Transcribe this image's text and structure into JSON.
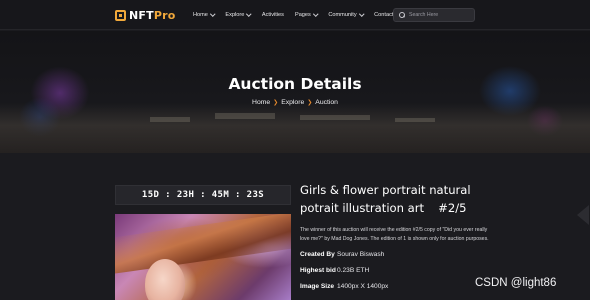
{
  "header": {
    "logo": {
      "prefix": "NFT",
      "suffix": "Pro"
    },
    "nav": [
      {
        "label": "Home",
        "has_dropdown": true
      },
      {
        "label": "Explore",
        "has_dropdown": true
      },
      {
        "label": "Activities",
        "has_dropdown": false
      },
      {
        "label": "Pages",
        "has_dropdown": true
      },
      {
        "label": "Community",
        "has_dropdown": true
      },
      {
        "label": "Contact",
        "has_dropdown": false
      }
    ],
    "search": {
      "placeholder": "Search Here",
      "value": ""
    }
  },
  "hero": {
    "title": "Auction Details",
    "breadcrumb": [
      "Home",
      "Explore",
      "Auction"
    ]
  },
  "auction": {
    "countdown": "15D : 23H : 45M : 23S",
    "title_main": "Girls & flower portrait natural potrait illustration art",
    "edition": "#2/5",
    "description": "The winner of this auction will receive the edition #2/5 copy of \"Did you ever really love me?\" by Mad Dog Jones. The edition of 1 is shown only for auction purposes.",
    "meta": [
      {
        "label": "Created By",
        "value": "Sourav Biswash"
      },
      {
        "label": "Highest bid",
        "value": "0.23B ETH"
      },
      {
        "label": "Image Size",
        "value": "1400px X 1400px"
      }
    ]
  },
  "watermark": "CSDN @light86",
  "colors": {
    "accent": "#f2a93b",
    "breadcrumb_separator": "#e2882d",
    "background": "#1b1b1f",
    "header_background": "#17171b"
  },
  "icons": [
    "logo-mark-icon",
    "chevron-down-icon",
    "search-icon",
    "chevron-right-icon"
  ]
}
